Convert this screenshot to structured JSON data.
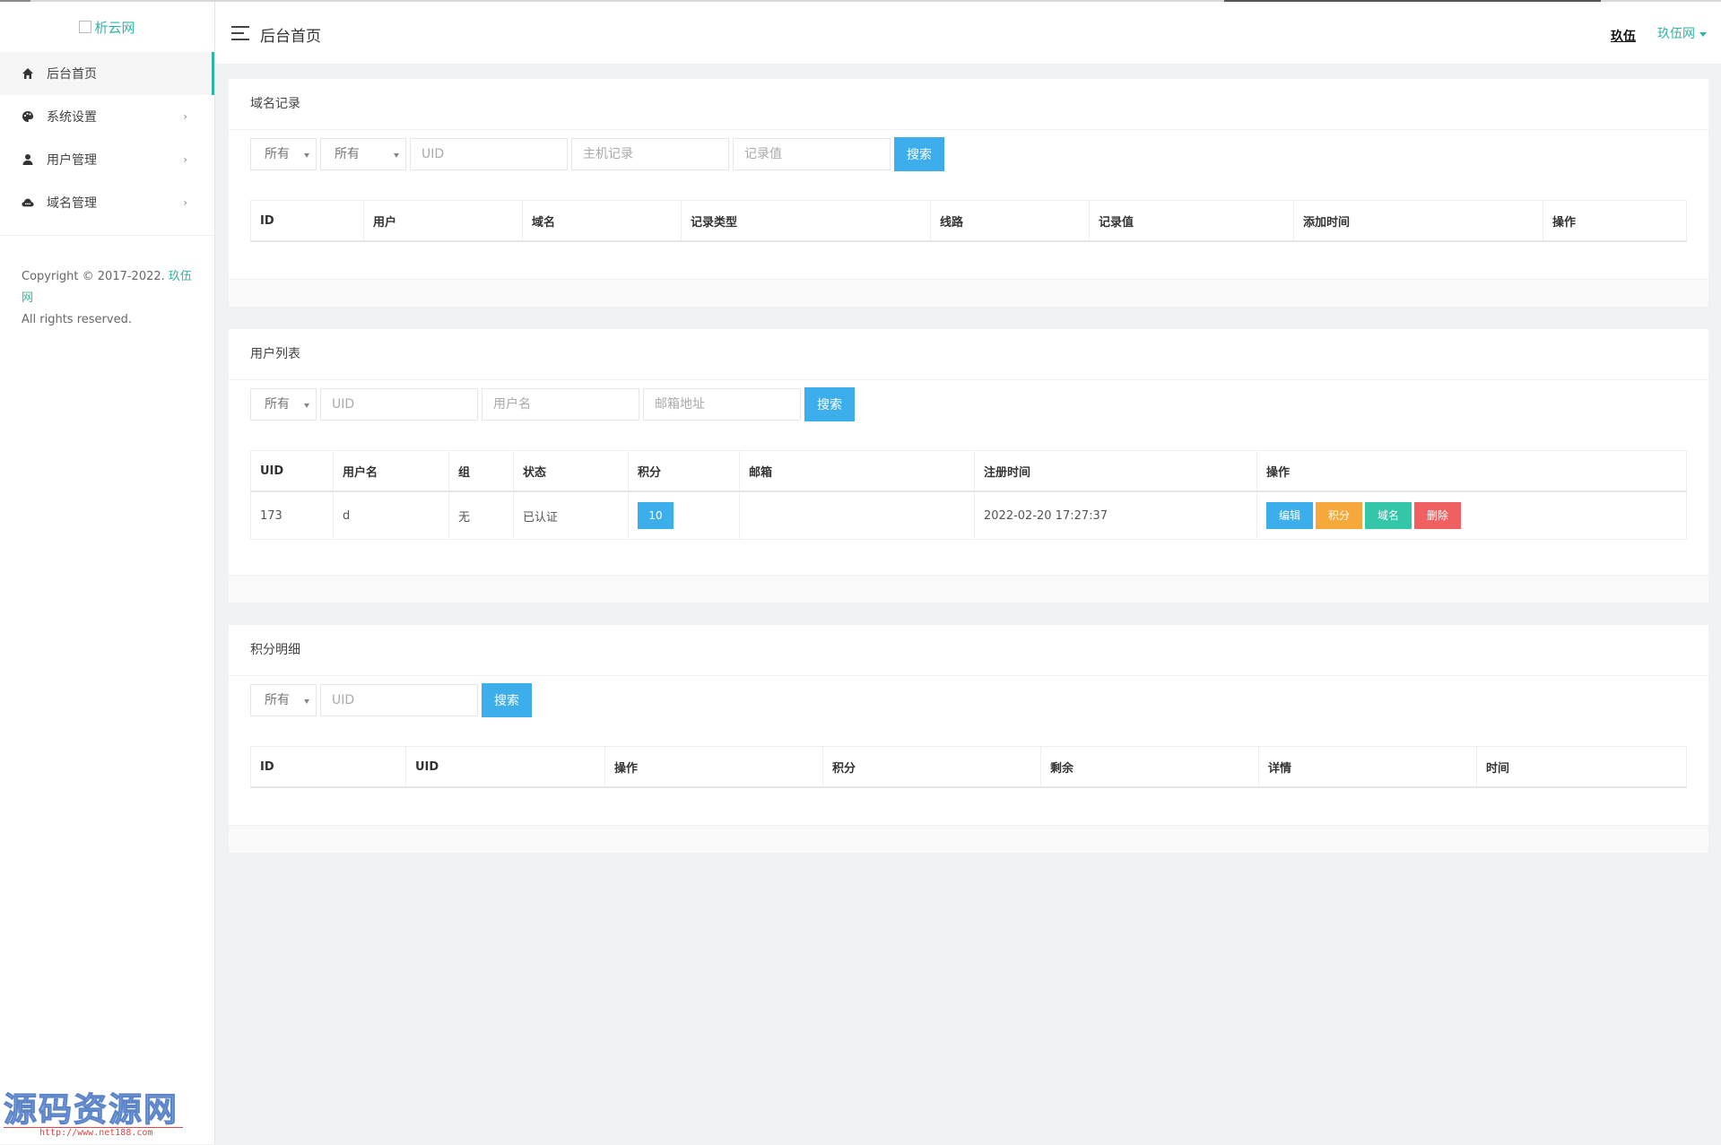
{
  "app": {
    "logo_alt": "析云网",
    "header_title": "后台首页",
    "header_user": "玖伍",
    "header_site": "玖伍网"
  },
  "sidebar": {
    "items": [
      {
        "label": "后台首页",
        "icon": "home-icon"
      },
      {
        "label": "系统设置",
        "icon": "palette-icon"
      },
      {
        "label": "用户管理",
        "icon": "user-icon"
      },
      {
        "label": "域名管理",
        "icon": "cloud-icon"
      }
    ],
    "copyright_prefix": "Copyright © 2017-2022. ",
    "copyright_link": "玖伍网",
    "copyright_suffix": "All rights reserved.",
    "watermark_main": "源码资源网",
    "watermark_sub": "http://www.net188.com"
  },
  "domain_records": {
    "title": "域名记录",
    "filter1": "所有",
    "filter2": "所有",
    "uid_placeholder": "UID",
    "host_placeholder": "主机记录",
    "value_placeholder": "记录值",
    "search_label": "搜索",
    "columns": [
      "ID",
      "用户",
      "域名",
      "记录类型",
      "线路",
      "记录值",
      "添加时间",
      "操作"
    ]
  },
  "user_list": {
    "title": "用户列表",
    "filter1": "所有",
    "uid_placeholder": "UID",
    "username_placeholder": "用户名",
    "email_placeholder": "邮箱地址",
    "search_label": "搜索",
    "columns": [
      "UID",
      "用户名",
      "组",
      "状态",
      "积分",
      "邮箱",
      "注册时间",
      "操作"
    ],
    "rows": [
      {
        "uid": "173",
        "username": "d",
        "group": "无",
        "status": "已认证",
        "score": "10",
        "email": "",
        "reg_time": "2022-02-20 17:27:37"
      }
    ],
    "actions": {
      "edit": "编辑",
      "score": "积分",
      "domain": "域名",
      "delete": "删除"
    }
  },
  "score_detail": {
    "title": "积分明细",
    "filter1": "所有",
    "uid_placeholder": "UID",
    "search_label": "搜索",
    "columns": [
      "ID",
      "UID",
      "操作",
      "积分",
      "剩余",
      "详情",
      "时间"
    ]
  },
  "colors": {
    "accent": "#2fb5a5",
    "primary_button": "#3daeec",
    "warning_button": "#f7a83a",
    "success_button": "#33c6a8",
    "danger_button": "#f06060"
  }
}
